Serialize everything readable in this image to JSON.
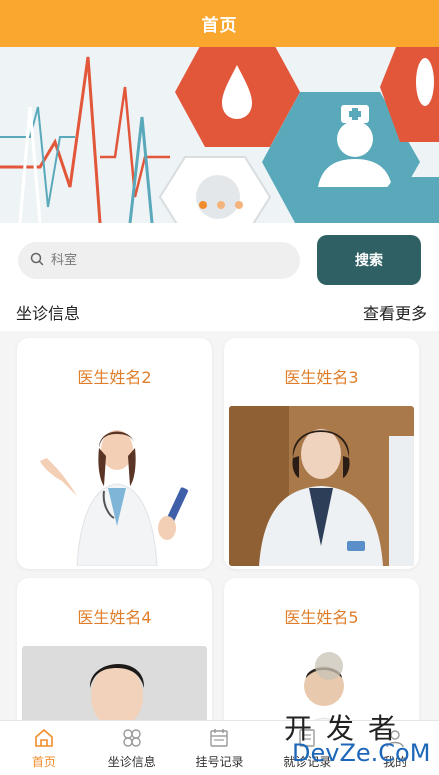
{
  "header": {
    "title": "首页"
  },
  "banner": {
    "dots": 3,
    "active_dot": 0
  },
  "search": {
    "placeholder": "科室",
    "value": "",
    "button_label": "搜索"
  },
  "section": {
    "title": "坐诊信息",
    "more_label": "查看更多"
  },
  "doctors": [
    {
      "name": "医生姓名2"
    },
    {
      "name": "医生姓名3"
    },
    {
      "name": "医生姓名4"
    },
    {
      "name": "医生姓名5"
    }
  ],
  "tabbar": {
    "items": [
      {
        "label": "首页",
        "icon": "home-icon",
        "active": true
      },
      {
        "label": "坐诊信息",
        "icon": "clover-icon",
        "active": false
      },
      {
        "label": "挂号记录",
        "icon": "calendar-icon",
        "active": false
      },
      {
        "label": "就诊记录",
        "icon": "record-icon",
        "active": false
      },
      {
        "label": "我的",
        "icon": "user-icon",
        "active": false
      }
    ]
  },
  "watermark": {
    "cn": "开发者",
    "en": "DevZe.CoM"
  },
  "colors": {
    "accent": "#f9a72f",
    "button": "#2e6064",
    "doctor_name": "#e07f2b",
    "tab_active": "#f08c2b"
  }
}
